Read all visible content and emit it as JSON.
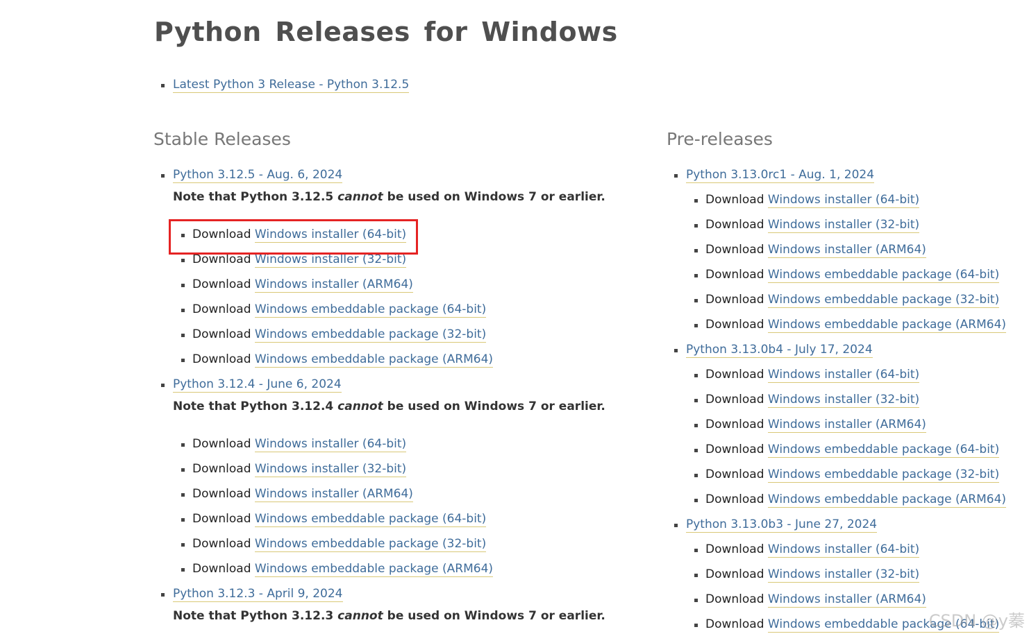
{
  "title": "Python Releases for Windows",
  "latest": "Latest Python 3 Release - Python 3.12.5",
  "stable": {
    "heading": "Stable Releases",
    "releases": [
      {
        "label": "Python 3.12.5 - Aug. 6, 2024",
        "note_before": "Note that Python 3.12.5 ",
        "note_em": "cannot",
        "note_after": " be used on Windows 7 or earlier.",
        "downloads": [
          "Windows installer (64-bit)",
          "Windows installer (32-bit)",
          "Windows installer (ARM64)",
          "Windows embeddable package (64-bit)",
          "Windows embeddable package (32-bit)",
          "Windows embeddable package (ARM64)"
        ]
      },
      {
        "label": "Python 3.12.4 - June 6, 2024",
        "note_before": "Note that Python 3.12.4 ",
        "note_em": "cannot",
        "note_after": " be used on Windows 7 or earlier.",
        "downloads": [
          "Windows installer (64-bit)",
          "Windows installer (32-bit)",
          "Windows installer (ARM64)",
          "Windows embeddable package (64-bit)",
          "Windows embeddable package (32-bit)",
          "Windows embeddable package (ARM64)"
        ]
      },
      {
        "label": "Python 3.12.3 - April 9, 2024",
        "note_before": "Note that Python 3.12.3 ",
        "note_em": "cannot",
        "note_after": " be used on Windows 7 or earlier."
      }
    ]
  },
  "pre": {
    "heading": "Pre-releases",
    "releases": [
      {
        "label": "Python 3.13.0rc1 - Aug. 1, 2024",
        "downloads": [
          "Windows installer (64-bit)",
          "Windows installer (32-bit)",
          "Windows installer (ARM64)",
          "Windows embeddable package (64-bit)",
          "Windows embeddable package (32-bit)",
          "Windows embeddable package (ARM64)"
        ]
      },
      {
        "label": "Python 3.13.0b4 - July 17, 2024",
        "downloads": [
          "Windows installer (64-bit)",
          "Windows installer (32-bit)",
          "Windows installer (ARM64)",
          "Windows embeddable package (64-bit)",
          "Windows embeddable package (32-bit)",
          "Windows embeddable package (ARM64)"
        ]
      },
      {
        "label": "Python 3.13.0b3 - June 27, 2024",
        "downloads": [
          "Windows installer (64-bit)",
          "Windows installer (32-bit)",
          "Windows installer (ARM64)",
          "Windows embeddable package (64-bit)"
        ]
      }
    ]
  },
  "download_prefix": "Download ",
  "watermark": "CSDN @y蓁",
  "colors": {
    "link": "#3f6c9a",
    "highlight_box": "#e52323"
  }
}
